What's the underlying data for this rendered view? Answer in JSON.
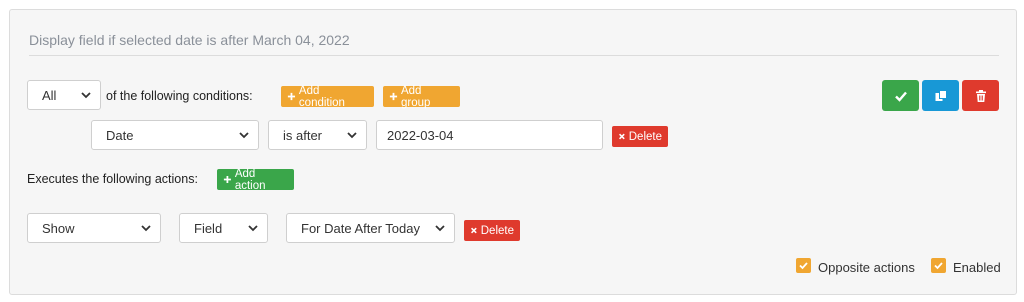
{
  "rule": {
    "title": "Display field if selected date is after March 04, 2022"
  },
  "conditions": {
    "match_select": "All",
    "label": "of the following conditions:",
    "add_condition": "Add condition",
    "add_group": "Add group",
    "row": {
      "field": "Date",
      "operator": "is after",
      "value": "2022-03-04",
      "delete": "Delete"
    }
  },
  "actions": {
    "label": "Executes the following actions:",
    "add_action": "Add action",
    "row": {
      "action": "Show",
      "type": "Field",
      "target": "For Date After Today",
      "delete": "Delete"
    }
  },
  "options": {
    "opposite_actions": "Opposite actions",
    "opposite_checked": true,
    "enabled": "Enabled",
    "enabled_checked": true
  },
  "icons": {
    "save": "check-icon",
    "copy": "copy-icon",
    "delete": "trash-icon"
  },
  "colors": {
    "orange": "#f0a631",
    "green": "#3aa64a",
    "blue": "#1898d6",
    "red": "#df3a2d"
  }
}
